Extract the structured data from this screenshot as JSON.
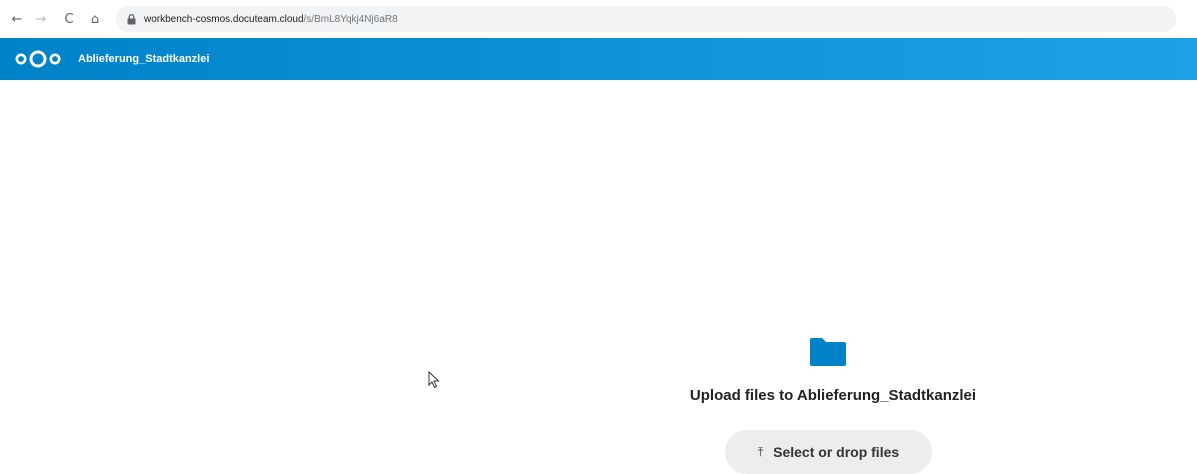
{
  "browser": {
    "back_glyph": "←",
    "forward_glyph": "→",
    "reload_glyph": "C",
    "home_glyph": "⌂",
    "url_host": "workbench-cosmos.docuteam.cloud",
    "url_path": "/s/BmL8Yqkj4Nj6aR8"
  },
  "header": {
    "share_title": "Ablieferung_Stadtkanzlei",
    "brand_color": "#0082c9"
  },
  "main": {
    "folder_icon": "folder-icon",
    "folder_color": "#0082c9",
    "upload_title": "Upload files to Ablieferung_Stadtkanzlei",
    "select_button_glyph": "⤒",
    "select_button_label": "Select or drop files"
  }
}
